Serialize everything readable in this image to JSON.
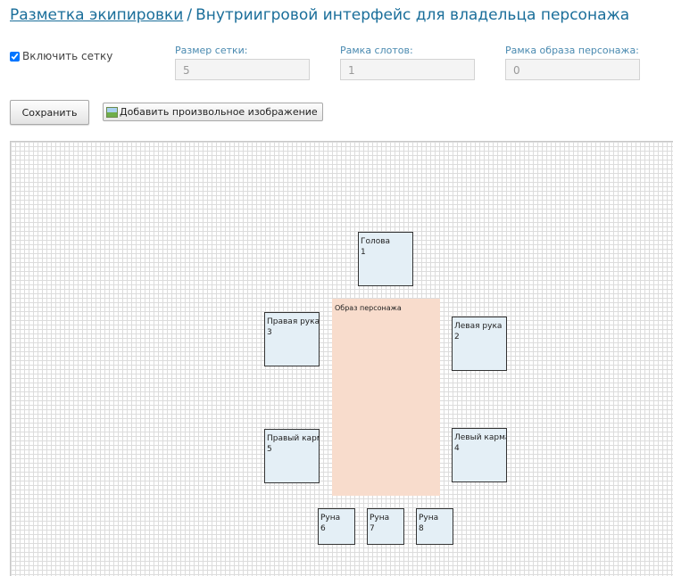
{
  "header": {
    "breadcrumb_link": "Разметка экипировки",
    "separator": "/",
    "title": "Внутриигровой интерфейс для владельца персонажа"
  },
  "settings": {
    "grid_checkbox_label": "Включить сетку",
    "grid_checkbox_checked": true,
    "grid_size": {
      "label": "Размер сетки:",
      "value": "5"
    },
    "slot_frame": {
      "label": "Рамка слотов:",
      "value": "1"
    },
    "char_frame": {
      "label": "Рамка образа персонажа:",
      "value": "0"
    }
  },
  "toolbar": {
    "save_label": "Сохранить",
    "add_image_label": "Добавить произвольное изображение"
  },
  "canvas": {
    "character_image_label": "Образ персонажа",
    "slots": [
      {
        "name": "Голова",
        "number": "1"
      },
      {
        "name": "Левая рука",
        "number": "2"
      },
      {
        "name": "Правая рука",
        "number": "3"
      },
      {
        "name": "Левый карман",
        "number": "4"
      },
      {
        "name": "Правый карман",
        "number": "5"
      },
      {
        "name": "Руна",
        "number": "6"
      },
      {
        "name": "Руна",
        "number": "7"
      },
      {
        "name": "Руна",
        "number": "8"
      }
    ]
  },
  "colors": {
    "link": "#1a6e9a",
    "slot_fill": "#e4eff6",
    "character_fill": "#f8dccc"
  }
}
